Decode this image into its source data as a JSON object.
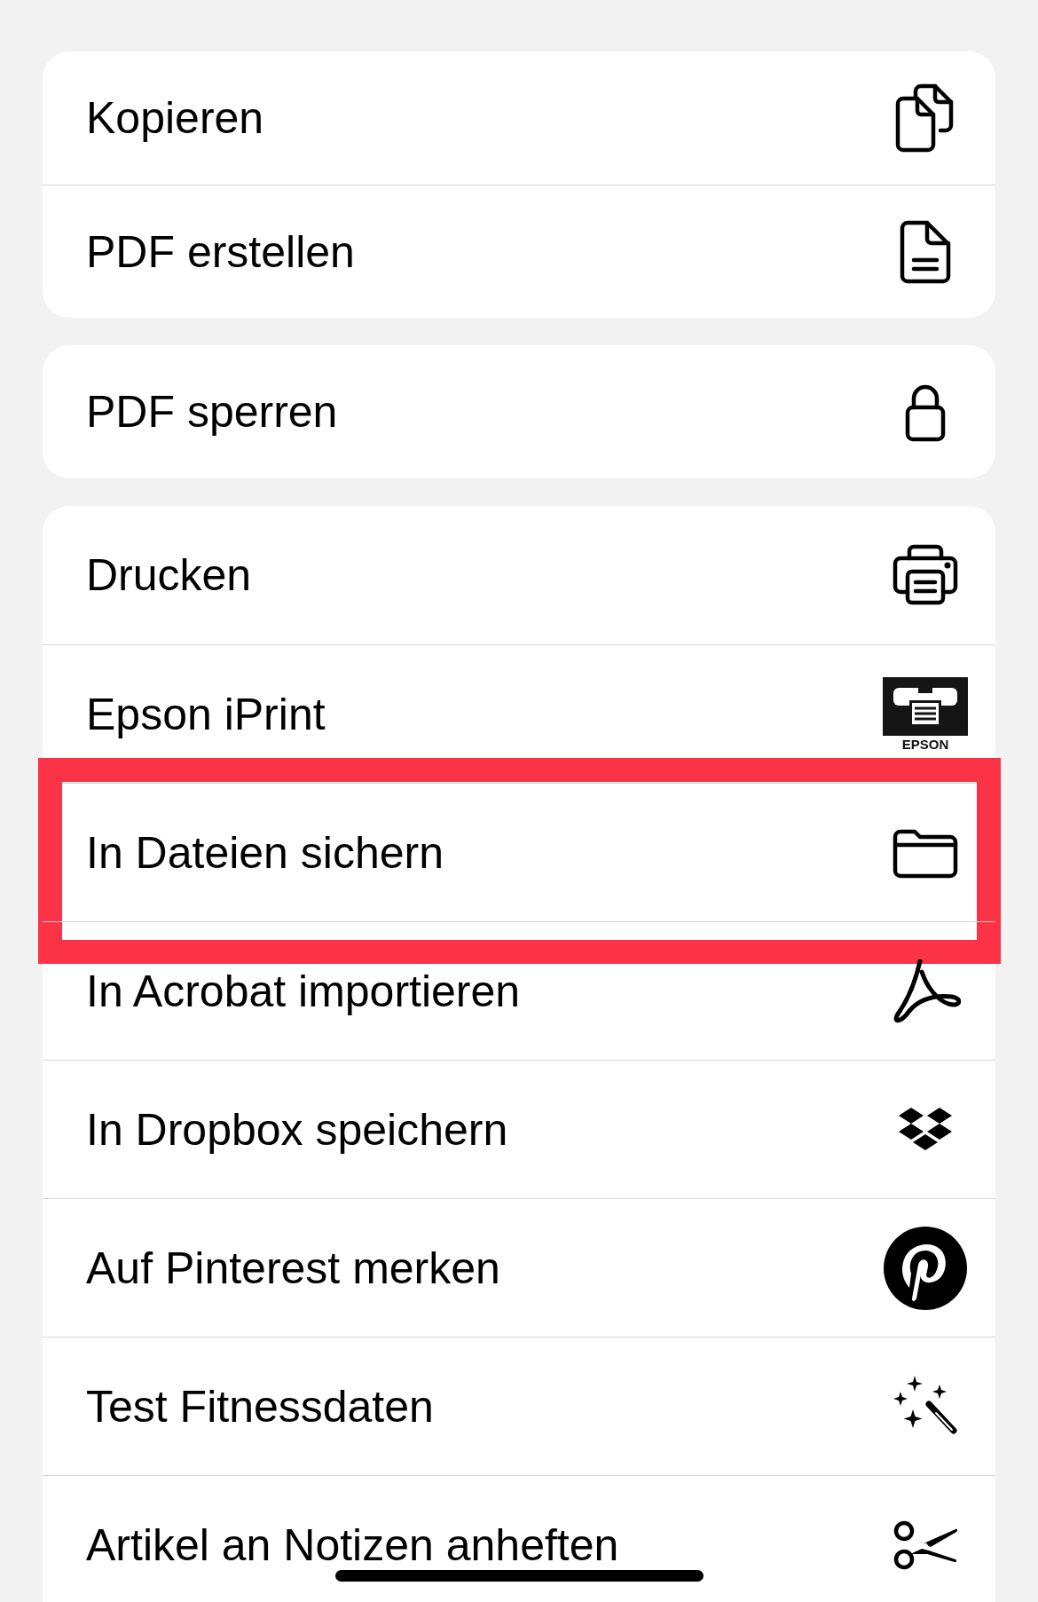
{
  "groups": [
    {
      "items": [
        {
          "label": "Kopieren",
          "highlighted": false
        },
        {
          "label": "PDF erstellen",
          "highlighted": false
        }
      ]
    },
    {
      "items": [
        {
          "label": "PDF sperren",
          "highlighted": false
        }
      ]
    },
    {
      "items": [
        {
          "label": "Drucken",
          "highlighted": false
        },
        {
          "label": "Epson iPrint",
          "highlighted": false,
          "icon_caption": "EPSON"
        },
        {
          "label": "In Dateien sichern",
          "highlighted": true
        },
        {
          "label": "In Acrobat importieren",
          "highlighted": false
        },
        {
          "label": "In Dropbox speichern",
          "highlighted": false
        },
        {
          "label": "Auf Pinterest merken",
          "highlighted": false
        },
        {
          "label": "Test Fitnessdaten",
          "highlighted": false
        },
        {
          "label": "Artikel an Notizen anheften",
          "highlighted": false
        }
      ]
    }
  ]
}
